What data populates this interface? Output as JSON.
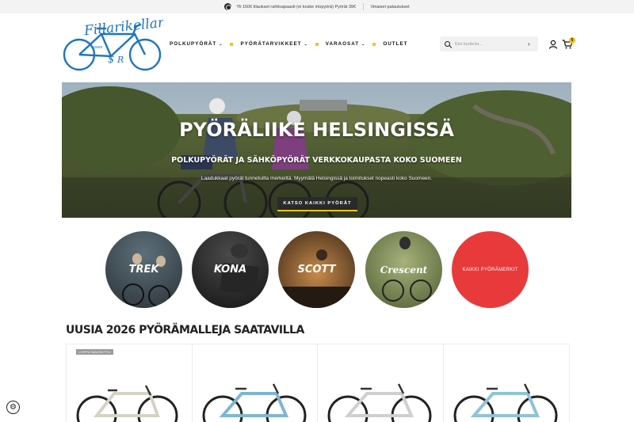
{
  "topbar": {
    "promo": "Yli 150€ tilaukset rahtivapaasti (ei koske irtopyörä) Pyörät 39€",
    "returns": "Ilmaiset palautukset"
  },
  "logo": {
    "name": "Fillarikellari"
  },
  "nav": [
    {
      "label": "POLKUPYÖRÄT",
      "has_dropdown": true
    },
    {
      "label": "PYÖRÄTARVIKKEET",
      "has_dropdown": true
    },
    {
      "label": "VARAOSAT",
      "has_dropdown": true
    },
    {
      "label": "OUTLET",
      "has_dropdown": false
    }
  ],
  "nav_dropdown_glyph": "⌄",
  "search": {
    "placeholder": "Etsi tuotteita...",
    "go_glyph": "›"
  },
  "cart": {
    "count": "0"
  },
  "hero": {
    "title": "PYÖRÄLIIKE HELSINGISSÄ",
    "subtitle": "POLKUPYÖRÄT JA SÄHKÖPYÖRÄT VERKKOKAUPASTA KOKO SUOMEEN",
    "description": "Laadukkaat pyörät tunnetuilta merkeiltä. Myymälä Helsingissä ja toimitukset nopeasti koko Suomeen.",
    "button": "KATSO KAIKKI PYÖRÄT"
  },
  "brands": [
    {
      "label": "TREK"
    },
    {
      "label": "KONA"
    },
    {
      "label": "SCOTT"
    },
    {
      "label": "Crescent"
    },
    {
      "label": "KAIKKI PYÖRÄMERKIT"
    }
  ],
  "new_bikes": {
    "title": "UUSIA 2026 PYÖRÄMALLEJA SAATAVILLA",
    "badge": "LOPPU MAKSETTU"
  },
  "colors": {
    "accent": "#f1c40f",
    "all_brands": "#e83a3a",
    "logo_blue": "#1c74c4"
  },
  "icons": {
    "globe": "globe-icon",
    "search": "search-icon",
    "account": "user-icon",
    "cart": "cart-icon",
    "cookie": "cookie-settings-icon"
  }
}
